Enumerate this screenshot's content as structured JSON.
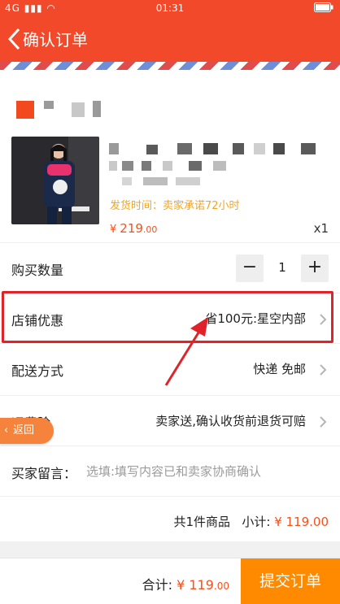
{
  "status_bar": {
    "signal": "4G",
    "time": "01:31"
  },
  "header": {
    "title": "确认订单"
  },
  "product": {
    "ship_time": "发货时间：卖家承诺72小时",
    "price_currency": "¥",
    "price_int": "219",
    "price_dec": ".00",
    "quantity_x": "x1"
  },
  "purchase_qty": {
    "label": "购买数量",
    "minus": "−",
    "value": "1",
    "plus": "+"
  },
  "shop_discount": {
    "label": "店铺优惠",
    "value": "省100元:星空内部"
  },
  "delivery": {
    "label": "配送方式",
    "value": "快递 免邮"
  },
  "insurance": {
    "label": "运费险",
    "value": "卖家送,确认收货前退货可赔"
  },
  "return_button": {
    "label": "返回"
  },
  "buyer_message": {
    "label": "买家留言：",
    "placeholder": "选填:填写内容已和卖家协商确认"
  },
  "summary": {
    "count_text": "共1件商品",
    "subtotal_label": "小计:",
    "subtotal_amount": "¥ 119.00"
  },
  "footer": {
    "total_label": "合计:",
    "total_currency": "¥",
    "total_int": "119",
    "total_dec": ".00",
    "submit_label": "提交订单"
  },
  "colors": {
    "brand_red": "#f2492a",
    "price_orange": "#f4511e",
    "submit_orange": "#ff8a00",
    "ship_yellow": "#f4a523",
    "highlight_red": "#e0232a"
  }
}
